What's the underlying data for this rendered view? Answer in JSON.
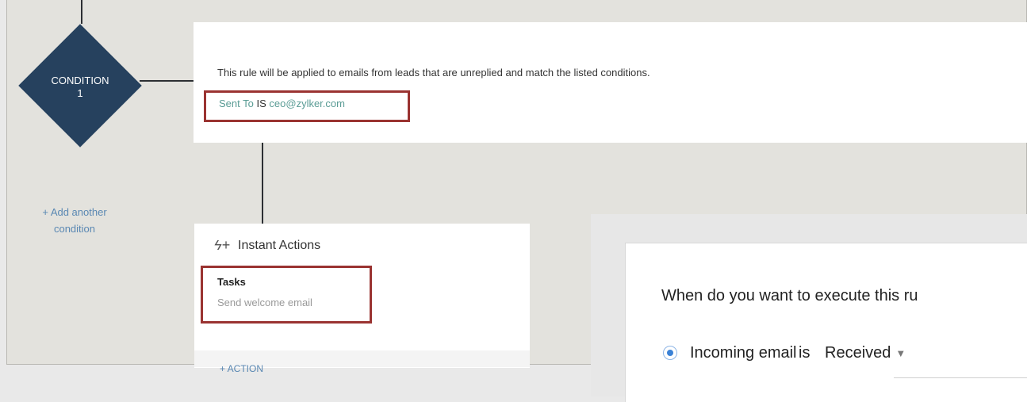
{
  "condition": {
    "label_line1": "CONDITION",
    "label_line2": "1",
    "rule_description": "This rule will be applied to emails from leads that are unreplied and match the listed conditions.",
    "criteria": {
      "field": "Sent To",
      "operator": "IS",
      "value": "ceo@zylker.com"
    }
  },
  "add_condition": {
    "line1": "+ Add another",
    "line2": "condition"
  },
  "instant_actions": {
    "title": "Instant Actions",
    "group_label": "Tasks",
    "item": "Send welcome email",
    "add_action": "+ ACTION"
  },
  "execute_popup": {
    "question": "When do you want to execute this ru",
    "option_label": "Incoming email",
    "option_operator": "is",
    "option_value": "Received"
  },
  "colors": {
    "diamond": "#26415e",
    "highlight_border": "#9a3331",
    "link": "#5a88b3",
    "criteria_teal": "#5a9c95",
    "radio_selected": "#3b82d6"
  },
  "icons": {
    "instant_action": "lightning-bolt-icon",
    "dropdown": "caret-down-icon"
  }
}
